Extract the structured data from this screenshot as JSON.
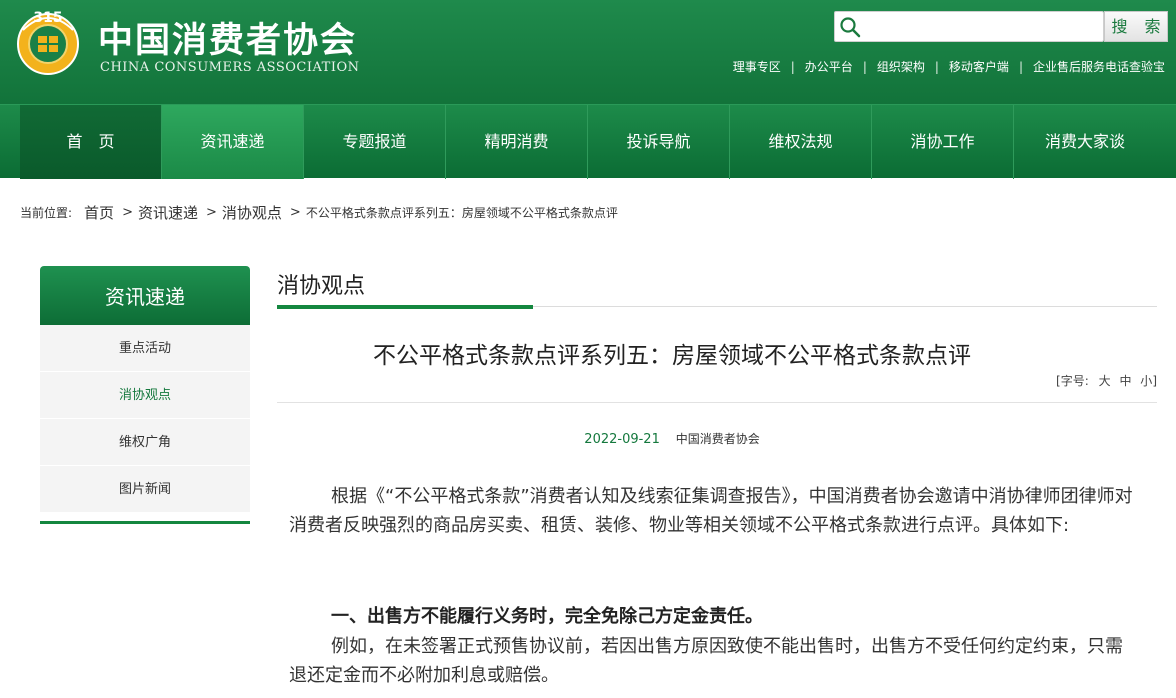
{
  "header": {
    "logo_cn": "中国消费者协会",
    "logo_en": "CHINA CONSUMERS ASSOCIATION",
    "emblem_text": "315",
    "search": {
      "placeholder": "",
      "button_label": "搜 索"
    },
    "top_links": [
      "理事专区",
      "办公平台",
      "组织架构",
      "移动客户端",
      "企业售后服务电话查验宝"
    ]
  },
  "nav": {
    "items": [
      "首　页",
      "资讯速递",
      "专题报道",
      "精明消费",
      "投诉导航",
      "维权法规",
      "消协工作",
      "消费大家谈"
    ],
    "active_index": 1
  },
  "breadcrumb": {
    "label": "当前位置:",
    "items": [
      "首页",
      "资讯速递",
      "消协观点"
    ],
    "separator": ">",
    "current": "不公平格式条款点评系列五：房屋领域不公平格式条款点评"
  },
  "sidebar": {
    "title": "资讯速递",
    "items": [
      "重点活动",
      "消协观点",
      "维权广角",
      "图片新闻"
    ],
    "active_index": 1
  },
  "main": {
    "section_title": "消协观点",
    "article_title": "不公平格式条款点评系列五：房屋领域不公平格式条款点评",
    "font_size_label": "[字号:",
    "font_size_options": [
      "大",
      "中",
      "小"
    ],
    "font_size_close": "]",
    "date": "2022-09-21",
    "source": "中国消费者协会",
    "paragraphs": [
      "根据《“不公平格式条款”消费者认知及线索征集调查报告》，中国消费者协会邀请中消协律师团律师对消费者反映强烈的商品房买卖、租赁、装修、物业等相关领域不公平格式条款进行点评。具体如下:"
    ],
    "heading1": "一、出售方不能履行义务时，完全免除己方定金责任。",
    "paragraph2": "例如，在未签署正式预售协议前，若因出售方原因致使不能出售时，出售方不受任何约定约束，只需退还定金而不必附加利息或赔偿。"
  },
  "colors": {
    "brand_green": "#12733a",
    "accent_green": "#14873f",
    "date_green": "#14783d"
  }
}
